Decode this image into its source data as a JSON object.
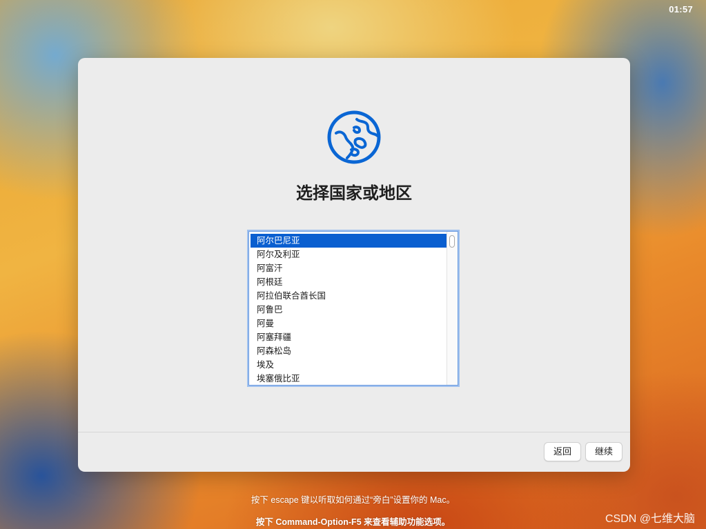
{
  "status_bar": {
    "clock": "01:57"
  },
  "setup": {
    "title": "选择国家或地区",
    "countries": [
      "阿尔巴尼亚",
      "阿尔及利亚",
      "阿富汗",
      "阿根廷",
      "阿拉伯联合酋长国",
      "阿鲁巴",
      "阿曼",
      "阿塞拜疆",
      "阿森松岛",
      "埃及",
      "埃塞俄比亚"
    ],
    "selected_country": "阿尔巴尼亚",
    "buttons": {
      "back": "返回",
      "continue": "继续"
    }
  },
  "hints": {
    "voiceover": "按下 escape 键以听取如何通过“旁白”设置你的 Mac。",
    "accessibility": "按下 Command-Option-F5 来查看辅助功能选项。"
  },
  "watermark": "CSDN @七维大脑",
  "colors": {
    "accent": "#0a5fd0",
    "globe": "#0a66d4",
    "window_bg": "#ececec"
  },
  "icons": {
    "globe": "globe-icon"
  }
}
